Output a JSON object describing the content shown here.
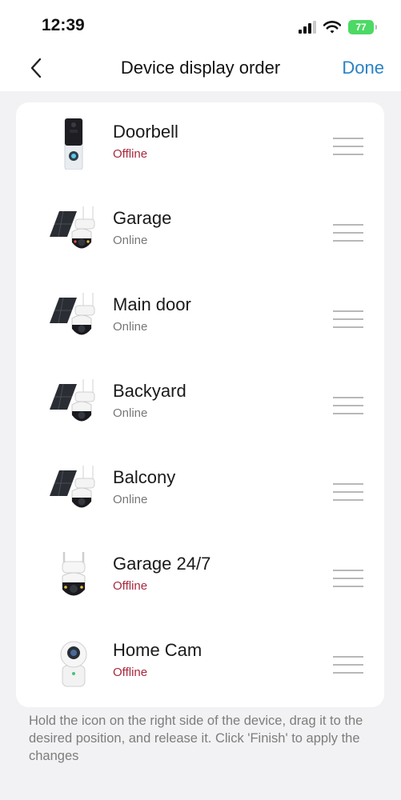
{
  "status_bar": {
    "time": "12:39",
    "battery": "77",
    "icons": [
      "cellular-signal-icon",
      "wifi-icon",
      "battery-charging-icon"
    ]
  },
  "nav": {
    "back_icon": "chevron-left-icon",
    "title": "Device display order",
    "done_label": "Done"
  },
  "devices": [
    {
      "name": "Doorbell",
      "status": "Offline",
      "type": "doorbell"
    },
    {
      "name": "Garage",
      "status": "Online",
      "type": "solar-ptz-camera"
    },
    {
      "name": "Main door",
      "status": "Online",
      "type": "solar-ptz-camera"
    },
    {
      "name": "Backyard",
      "status": "Online",
      "type": "solar-ptz-camera"
    },
    {
      "name": "Balcony",
      "status": "Online",
      "type": "solar-ptz-camera"
    },
    {
      "name": "Garage 24/7",
      "status": "Offline",
      "type": "ptz-camera"
    },
    {
      "name": "Home Cam",
      "status": "Offline",
      "type": "indoor-camera"
    }
  ],
  "hint": "Hold the icon on the right side of the device, drag it to the desired position, and release it. Click 'Finish' to apply the changes",
  "colors": {
    "accent": "#2a82c5",
    "offline": "#a8283d",
    "online": "#777777",
    "battery": "#4cd964",
    "background": "#f2f2f4"
  }
}
